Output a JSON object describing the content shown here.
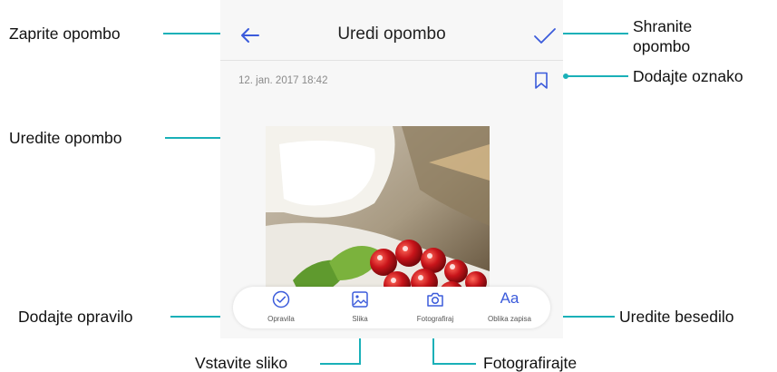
{
  "app": {
    "header_title": "Uredi opombo",
    "date": "12. jan. 2017 18:42"
  },
  "toolbar": [
    {
      "label": "Opravila",
      "icon": "checklist-icon"
    },
    {
      "label": "Slika",
      "icon": "image-icon"
    },
    {
      "label": "Fotografiraj",
      "icon": "camera-icon"
    },
    {
      "label": "Oblika zapisa",
      "icon": "text-format-icon",
      "glyph": "Aa"
    }
  ],
  "callouts": {
    "close_note": "Zaprite opombo",
    "save_note_line1": "Shranite",
    "save_note_line2": "opombo",
    "add_bookmark": "Dodajte oznako",
    "edit_note": "Uredite opombo",
    "add_task": "Dodajte opravilo",
    "edit_text": "Uredite besedilo",
    "insert_image": "Vstavite sliko",
    "take_photo": "Fotografirajte"
  },
  "colors": {
    "accent": "#3b5bdb",
    "leader_line": "#1ab0b8",
    "screen_bg": "#f7f7f7"
  }
}
